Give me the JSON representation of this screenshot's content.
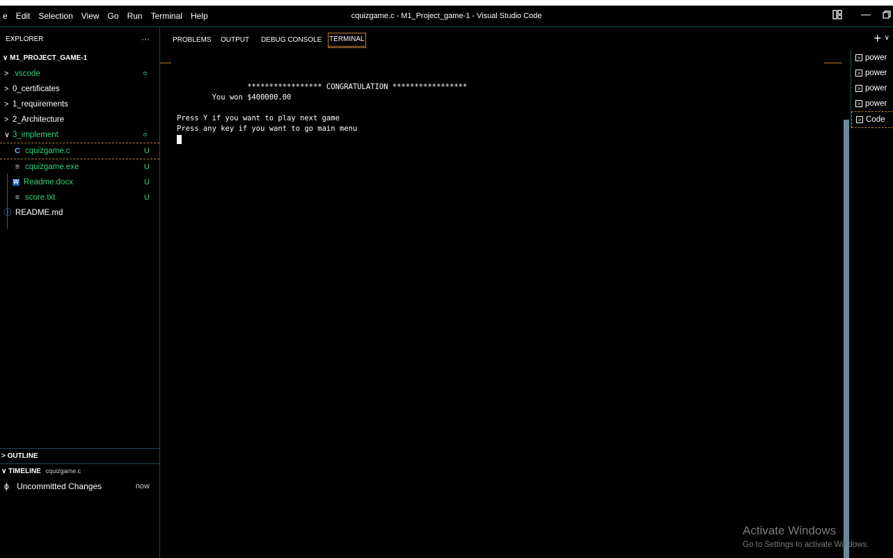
{
  "menu": [
    "e",
    "Edit",
    "Selection",
    "View",
    "Go",
    "Run",
    "Terminal",
    "Help"
  ],
  "window_title": "cquizgame.c - M1_Project_game-1 - Visual Studio Code",
  "sidebar": {
    "header": "EXPLORER",
    "more": "···",
    "root": "M1_PROJECT_GAME-1",
    "items": [
      {
        "label": ".vscode",
        "chevron": ">",
        "status": "dot"
      },
      {
        "label": "0_certificates",
        "chevron": ">"
      },
      {
        "label": "1_requirements",
        "chevron": ">"
      },
      {
        "label": "2_Architecture",
        "chevron": ">"
      },
      {
        "label": "3_implement",
        "chevron": "∨",
        "status": "dot"
      }
    ],
    "files": [
      {
        "label": "cquizgame.c",
        "icon": "C",
        "badge": "U"
      },
      {
        "label": "cquizgame.exe",
        "icon": "≡",
        "badge": "U"
      },
      {
        "label": "Readme.docx",
        "icon": "W",
        "badge": "U"
      },
      {
        "label": "score.txt",
        "icon": "≡",
        "badge": "U"
      }
    ],
    "readme": {
      "label": "README.md",
      "icon": "ⓘ"
    },
    "outline": "OUTLINE",
    "timeline": "TIMELINE",
    "timeline_file": "cquizgame.c",
    "timeline_item": "Uncommitted Changes",
    "timeline_when": "now"
  },
  "panel": {
    "tabs": [
      "PROBLEMS",
      "OUTPUT",
      "DEBUG CONSOLE",
      "TERMINAL"
    ],
    "plus": "+",
    "chevron": "∨"
  },
  "terminal": {
    "line1": "                ***************** CONGRATULATION *****************",
    "line2": "        You won $400000.00",
    "line3": "Press Y if you want to play next game",
    "line4": "Press any key if you want to go main menu"
  },
  "terminal_list": [
    "power",
    "power",
    "power",
    "power",
    "Code"
  ],
  "watermark": {
    "title": "Activate Windows",
    "subtitle": "Go to Settings to activate Windows."
  }
}
